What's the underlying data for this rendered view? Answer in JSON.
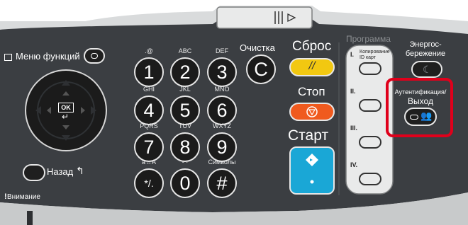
{
  "menu": {
    "label": "Меню функций"
  },
  "clear": {
    "label": "Очистка",
    "key": "C"
  },
  "reset": {
    "label": "Сброс",
    "color": "#f2c811"
  },
  "stop": {
    "label": "Стоп",
    "color": "#f05a1e"
  },
  "start": {
    "label": "Старт",
    "color": "#1aa7d6"
  },
  "program": {
    "title": "Программа",
    "items": [
      {
        "roman": "I.",
        "text1": "Копирование",
        "text2": "ID карт"
      },
      {
        "roman": "II.",
        "text1": "",
        "text2": ""
      },
      {
        "roman": "III.",
        "text1": "",
        "text2": ""
      },
      {
        "roman": "IV.",
        "text1": "",
        "text2": ""
      }
    ]
  },
  "energy": {
    "label_line1": "Энергос-",
    "label_line2": "бережение"
  },
  "auth": {
    "label_line1": "Аутентификация/",
    "label_line2": "Выход",
    "highlight_color": "#e0001b"
  },
  "back": {
    "label": "Назад"
  },
  "attention": {
    "label": "Внимание"
  },
  "navpad": {
    "center": "OK"
  },
  "keypad": [
    {
      "digit": "1",
      "letters": ".@"
    },
    {
      "digit": "2",
      "letters": "ABC"
    },
    {
      "digit": "3",
      "letters": "DEF"
    },
    {
      "digit": "4",
      "letters": "GHI"
    },
    {
      "digit": "5",
      "letters": "JKL"
    },
    {
      "digit": "6",
      "letters": "MNO"
    },
    {
      "digit": "7",
      "letters": "PQRS"
    },
    {
      "digit": "8",
      "letters": "TUV"
    },
    {
      "digit": "9",
      "letters": "WXYZ"
    },
    {
      "digit": "*/.",
      "letters": "a↔A"
    },
    {
      "digit": "0",
      "letters": "- ·"
    },
    {
      "digit": "#",
      "letters": "Символы"
    }
  ]
}
